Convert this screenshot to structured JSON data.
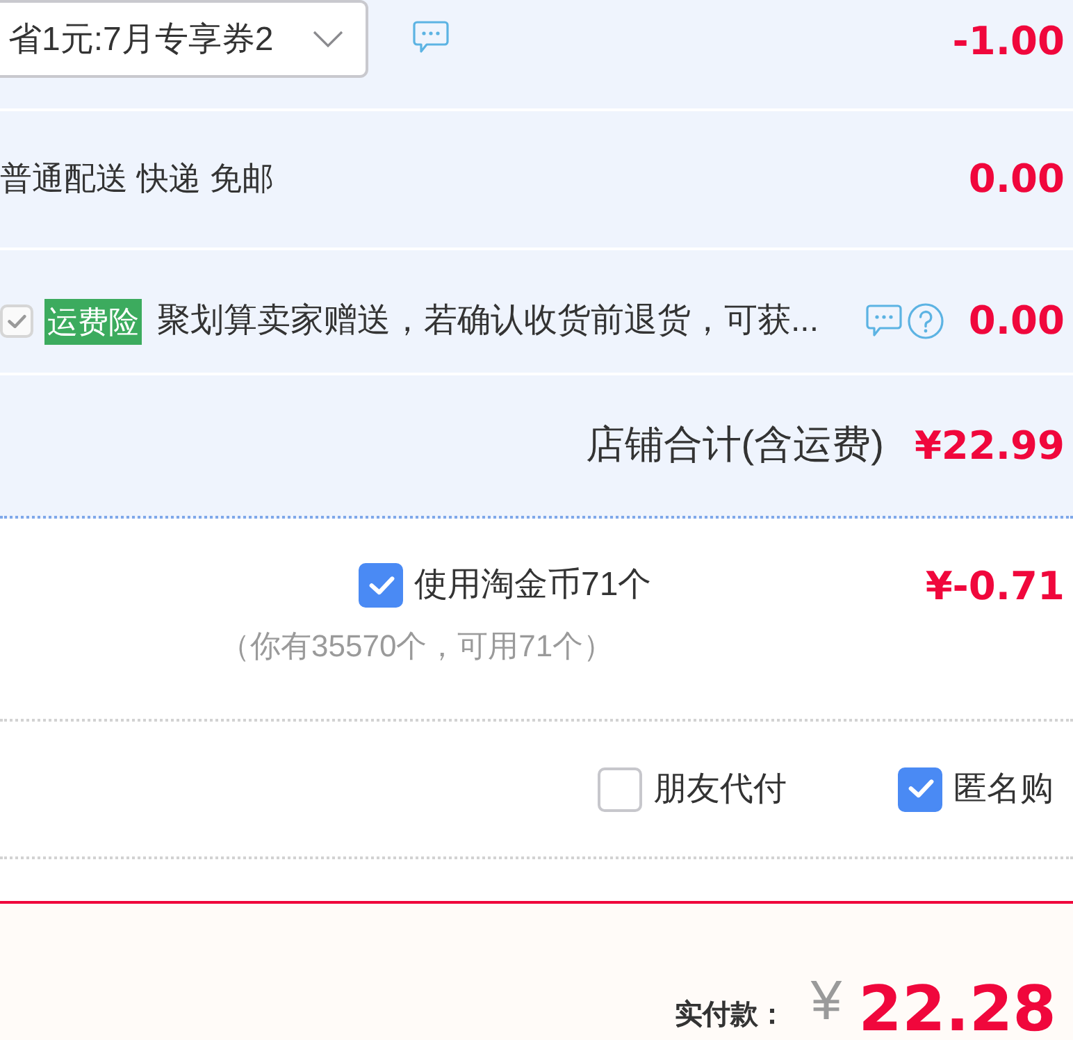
{
  "coupon_row": {
    "selector": {
      "value": "省1元:7月专享券2"
    },
    "amount": "-1.00"
  },
  "delivery_row": {
    "text": "普通配送 快递 免邮",
    "amount": "0.00"
  },
  "insurance_row": {
    "checkbox": {
      "checked": true,
      "disabled": true
    },
    "tag": "运费险",
    "description": "聚划算卖家赠送，若确认收货前退货，可获...",
    "amount": "0.00"
  },
  "store_total": {
    "label": "店铺合计(含运费)",
    "amount": "¥22.99"
  },
  "coins": {
    "checked": true,
    "label": "使用淘金币71个",
    "note": "（你有35570个，可用71个）",
    "amount": "¥-0.71"
  },
  "options": [
    {
      "label": "朋友代付",
      "checked": false
    },
    {
      "label": "匿名购",
      "checked": true
    }
  ],
  "footer": {
    "label": "实付款：",
    "currency": "¥",
    "amount": "22.28"
  }
}
